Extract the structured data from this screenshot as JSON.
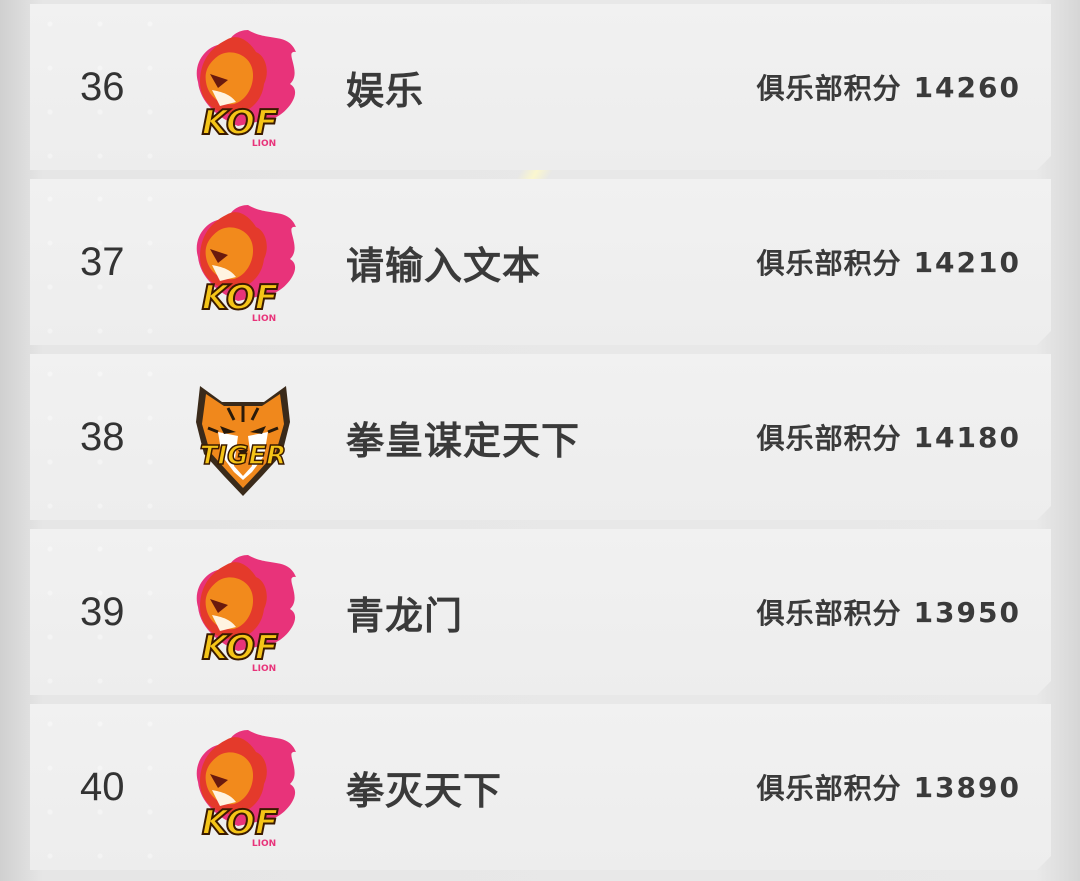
{
  "leaderboard": {
    "score_label": "俱乐部积分",
    "rows": [
      {
        "rank": "36",
        "name": "娱乐",
        "score": "14260",
        "logo": "kof-lion-icon"
      },
      {
        "rank": "37",
        "name": "请输入文本",
        "score": "14210",
        "logo": "kof-lion-icon"
      },
      {
        "rank": "38",
        "name": "拳皇谋定天下",
        "score": "14180",
        "logo": "tiger-icon"
      },
      {
        "rank": "39",
        "name": "青龙门",
        "score": "13950",
        "logo": "kof-lion-icon"
      },
      {
        "rank": "40",
        "name": "拳灭天下",
        "score": "13890",
        "logo": "kof-lion-icon"
      }
    ]
  },
  "logos": {
    "kof": {
      "text": "KOF",
      "subtext": "LION"
    },
    "tiger": {
      "text": "TIGER"
    }
  },
  "colors": {
    "lion_flame_red": "#e43a2b",
    "lion_flame_pink": "#e8337a",
    "lion_mane_orange": "#f28a1c",
    "logo_yellow": "#f5c417",
    "tiger_orange": "#f0881c"
  }
}
